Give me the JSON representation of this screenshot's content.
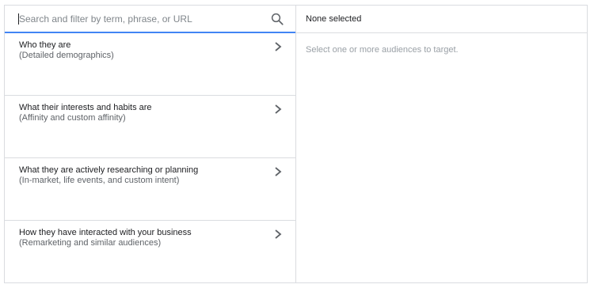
{
  "search": {
    "placeholder": "Search and filter by term, phrase, or URL",
    "icon": "search-icon"
  },
  "categories": [
    {
      "title": "Who they are",
      "subtitle": "(Detailed demographics)",
      "icon": "chevron-right-icon"
    },
    {
      "title": "What their interests and habits are",
      "subtitle": "(Affinity and custom affinity)",
      "icon": "chevron-right-icon"
    },
    {
      "title": "What they are actively researching or planning",
      "subtitle": "(In-market, life events, and custom intent)",
      "icon": "chevron-right-icon"
    },
    {
      "title": "How they have interacted with your business",
      "subtitle": "(Remarketing and similar audiences)",
      "icon": "chevron-right-icon"
    }
  ],
  "selection": {
    "header": "None selected",
    "empty_message": "Select one or more audiences to target."
  },
  "colors": {
    "accent": "#4285f4",
    "border": "#dadce0",
    "muted_text": "#9aa0a6"
  }
}
